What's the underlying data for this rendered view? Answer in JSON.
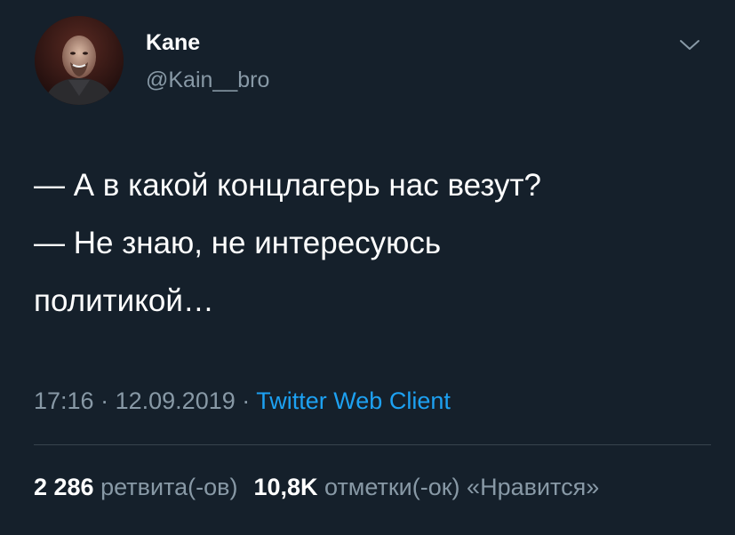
{
  "tweet": {
    "author_name": "Kane",
    "author_handle": "@Kain__bro",
    "lines": [
      "— А в какой концлагерь нас везут?",
      "— Не знаю, не интересуюсь",
      "политикой…"
    ],
    "time": "17:16",
    "date": "12.09.2019",
    "separator": "·",
    "client": "Twitter Web Client",
    "retweet_count": "2 286",
    "retweet_label": "ретвита(-ов)",
    "like_count": "10,8K",
    "like_label": "отметки(-ок) «Нравится»"
  },
  "icons": {
    "menu": "chevron-down-icon"
  },
  "colors": {
    "background": "#15202b",
    "text_primary": "#ffffff",
    "text_secondary": "#8899a6",
    "link": "#1da1f2",
    "divider": "#38444d"
  }
}
